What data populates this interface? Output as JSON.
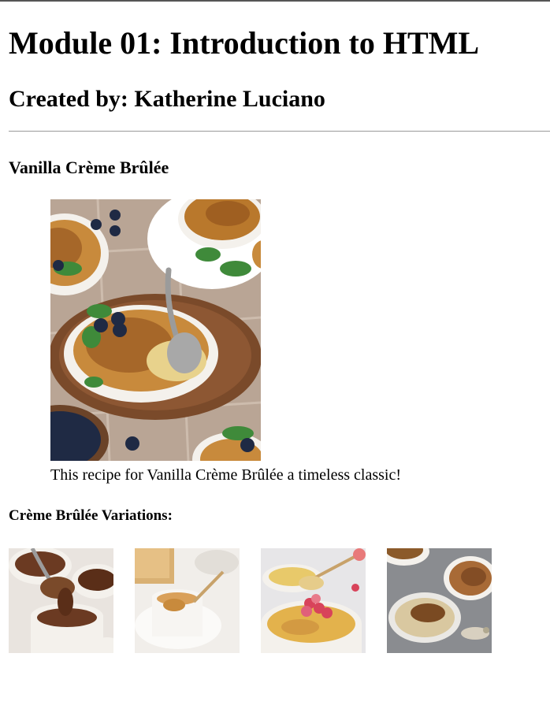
{
  "page": {
    "title": "Module 01: Introduction to HTML",
    "author_line": "Created by: Katherine Luciano"
  },
  "recipe": {
    "title": "Vanilla Crème Brûlée",
    "caption": "This recipe for Vanilla Crème Brûlée a timeless classic!"
  },
  "variations": {
    "heading": "Crème Brûlée Variations:"
  },
  "colors": {
    "custard": "#c88a3c",
    "caramel": "#8b4a1a",
    "ramekin": "#f4f1ec",
    "wood": "#7a4a2a",
    "tile": "#b8a596",
    "blueberry": "#1f2a44",
    "mint": "#3f8a3a",
    "chocolate": "#6b3a22",
    "raspberry": "#d8435a",
    "stone": "#8a8c90"
  }
}
